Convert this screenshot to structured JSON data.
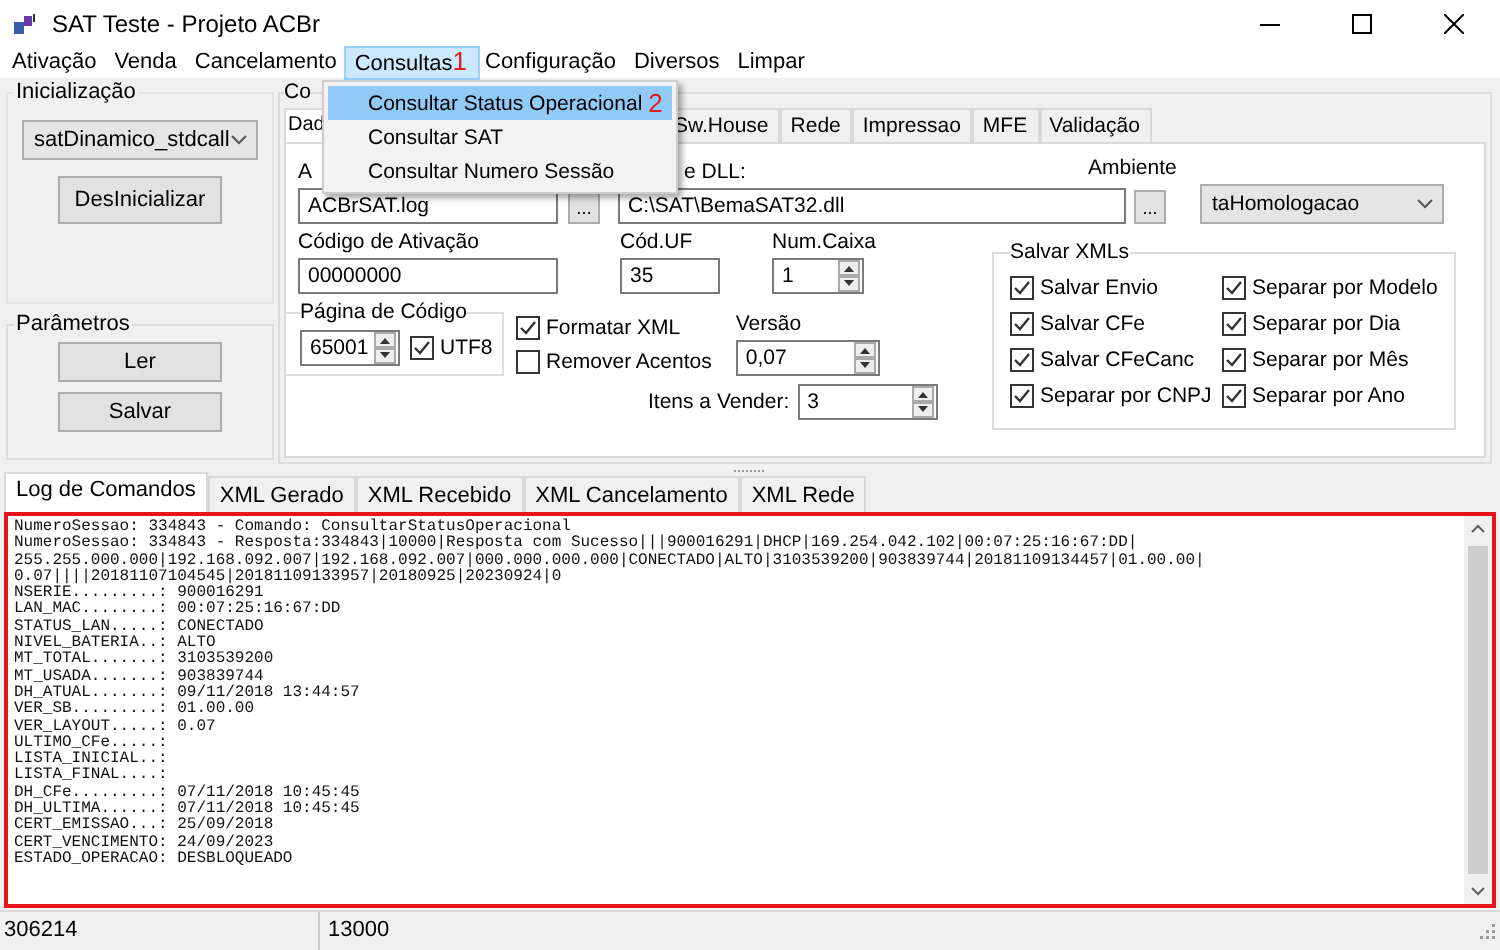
{
  "window": {
    "title": "SAT Teste - Projeto ACBr"
  },
  "menu": [
    {
      "label": "Ativação",
      "selected": false
    },
    {
      "label": "Venda",
      "selected": false
    },
    {
      "label": "Cancelamento",
      "selected": false
    },
    {
      "label": "Consultas",
      "selected": true,
      "marker": "1"
    },
    {
      "label": "Configuração",
      "selected": false
    },
    {
      "label": "Diversos",
      "selected": false
    },
    {
      "label": "Limpar",
      "selected": false
    }
  ],
  "dropdown": [
    {
      "label": "Consultar Status Operacional",
      "selected": true,
      "marker": "2"
    },
    {
      "label": "Consultar SAT",
      "selected": false
    },
    {
      "label": "Consultar Numero Sessão",
      "selected": false
    }
  ],
  "inicializacao": {
    "title": "Inicialização",
    "library": "satDinamico_stdcall",
    "button": "DesInicializar"
  },
  "parametros": {
    "title": "Parâmetros",
    "buttons": [
      "Ler",
      "Salvar"
    ]
  },
  "config": {
    "title": "Co",
    "tabs": [
      {
        "label": "Dad",
        "selected": true
      },
      {
        "label": "Sw.House",
        "selected": false
      },
      {
        "label": "Rede",
        "selected": false
      },
      {
        "label": "Impressao",
        "selected": false
      },
      {
        "label": "MFE",
        "selected": false
      },
      {
        "label": "Validação",
        "selected": false
      }
    ],
    "log_file": {
      "label": "A",
      "value": "ACBrSAT.log",
      "browse": "..."
    },
    "dll": {
      "label": "e DLL:",
      "value": "C:\\SAT\\BemaSAT32.dll",
      "browse": "..."
    },
    "ambiente": {
      "label": "Ambiente",
      "value": "taHomologacao"
    },
    "codigo_ativacao": {
      "label": "Código de Ativação",
      "value": "00000000"
    },
    "cod_uf": {
      "label": "Cód.UF",
      "value": "35"
    },
    "num_caixa": {
      "label": "Num.Caixa",
      "value": "1"
    },
    "pagina_codigo": {
      "title": "Página de Código",
      "value": "65001",
      "utf8": {
        "label": "UTF8",
        "checked": true
      }
    },
    "options": [
      {
        "label": "Formatar XML",
        "checked": true
      },
      {
        "label": "Remover Acentos",
        "checked": false
      }
    ],
    "versao": {
      "label": "Versão",
      "value": "0,07"
    },
    "itens": {
      "label": "Itens a Vender:",
      "value": "3"
    },
    "salvar_xmls": {
      "title": "Salvar XMLs",
      "options": [
        {
          "label": "Salvar Envio",
          "checked": true
        },
        {
          "label": "Separar por Modelo",
          "checked": true
        },
        {
          "label": "Salvar CFe",
          "checked": true
        },
        {
          "label": "Separar por Dia",
          "checked": true
        },
        {
          "label": "Salvar CFeCanc",
          "checked": true
        },
        {
          "label": "Separar por Mês",
          "checked": true
        },
        {
          "label": "Separar por CNPJ",
          "checked": true
        },
        {
          "label": "Separar por Ano",
          "checked": true
        }
      ]
    }
  },
  "bottom_tabs": [
    {
      "label": "Log de Comandos",
      "selected": true
    },
    {
      "label": "XML Gerado",
      "selected": false
    },
    {
      "label": "XML Recebido",
      "selected": false
    },
    {
      "label": "XML Cancelamento",
      "selected": false
    },
    {
      "label": "XML Rede",
      "selected": false
    }
  ],
  "log": [
    "NumeroSessao: 334843 - Comando: ConsultarStatusOperacional",
    "NumeroSessao: 334843 - Resposta:334843|10000|Resposta com Sucesso|||900016291|DHCP|169.254.042.102|00:07:25:16:67:DD|",
    "255.255.000.000|192.168.092.007|192.168.092.007|000.000.000.000|CONECTADO|ALTO|3103539200|903839744|20181109134457|01.00.00|",
    "0.07||||20181107104545|20181109133957|20180925|20230924|0",
    "NSERIE.........: 900016291",
    "LAN_MAC........: 00:07:25:16:67:DD",
    "STATUS_LAN.....: CONECTADO",
    "NIVEL_BATERIA..: ALTO",
    "MT_TOTAL.......: 3103539200",
    "MT_USADA.......: 903839744",
    "DH_ATUAL.......: 09/11/2018 13:44:57",
    "VER_SB.........: 01.00.00",
    "VER_LAYOUT.....: 0.07",
    "ULTIMO_CFe.....:",
    "LISTA_INICIAL..:",
    "LISTA_FINAL....:",
    "DH_CFe.........: 07/11/2018 10:45:45",
    "DH_ULTIMA......: 07/11/2018 10:45:45",
    "CERT_EMISSAO...: 25/09/2018",
    "CERT_VENCIMENTO: 24/09/2023",
    "ESTADO_OPERACAO: DESBLOQUEADO"
  ],
  "status_bar": [
    "306214",
    "13000"
  ]
}
